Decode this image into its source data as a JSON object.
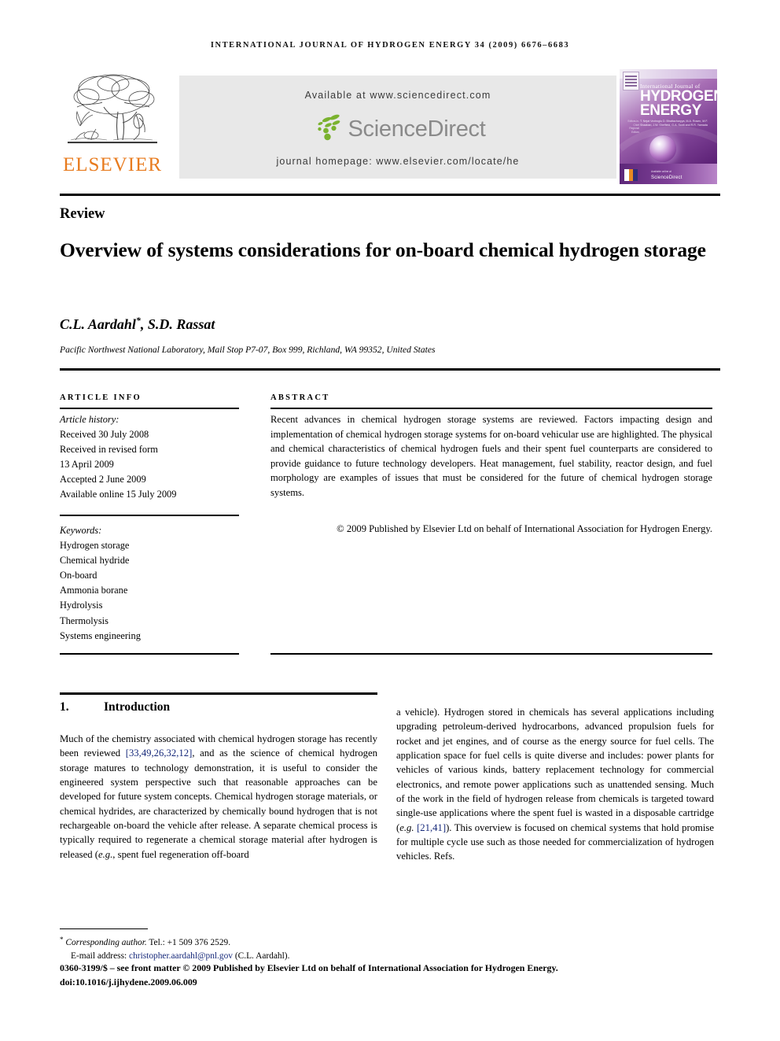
{
  "running_head": "International Journal of Hydrogen Energy 34 (2009) 6676–6683",
  "masthead": {
    "elsevier_wordmark": "ELSEVIER",
    "available_at": "Available at www.sciencedirect.com",
    "sciencedirect_wordmark": "ScienceDirect",
    "journal_homepage": "journal homepage: www.elsevier.com/locate/he",
    "accent_orange": "#E87B1E",
    "banner_gray": "#e8e8e8",
    "logo_gray": "#8a8a8a",
    "leaf_green": "#7AB22E"
  },
  "cover": {
    "intl_journal_of": "International Journal of",
    "hydrogen": "HYDROGEN",
    "energy": "ENERGY",
    "editors_label": "Editors-in-Chief\nRegional Editors",
    "editors": "T. Nejat Veziroglu\nD. Bhattacharyya, M.A. Rosen,\nM.F. Shaaban, J.W. Sheffield,\nG.A. Scott and R.R. Yamada",
    "sciencedirect_small": "ScienceDirect",
    "sciencedirect_tag": "Available online at",
    "bg_purple": "#7b3f93"
  },
  "article": {
    "review_label": "Review",
    "title": "Overview of systems considerations for on-board chemical hydrogen storage",
    "authors_text": "C.L. Aardahl",
    "authors_rest": ", S.D. Rassat",
    "author_marker": "*",
    "affiliation": "Pacific Northwest National Laboratory, Mail Stop P7-07, Box 999, Richland, WA 99352, United States"
  },
  "info": {
    "heading": "Article Info",
    "history_label": "Article history:",
    "history": [
      "Received 30 July 2008",
      "Received in revised form",
      "13 April 2009",
      "Accepted 2 June 2009",
      "Available online 15 July 2009"
    ],
    "keywords_label": "Keywords:",
    "keywords": [
      "Hydrogen storage",
      "Chemical hydride",
      "On-board",
      "Ammonia borane",
      "Hydrolysis",
      "Thermolysis",
      "Systems engineering"
    ]
  },
  "abstract": {
    "heading": "Abstract",
    "body": "Recent advances in chemical hydrogen storage systems are reviewed. Factors impacting design and implementation of chemical hydrogen storage systems for on-board vehicular use are highlighted. The physical and chemical characteristics of chemical hydrogen fuels and their spent fuel counterparts are considered to provide guidance to future technology developers. Heat management, fuel stability, reactor design, and fuel morphology are examples of issues that must be considered for the future of chemical hydrogen storage systems.",
    "copyright": "© 2009 Published by Elsevier Ltd on behalf of International Association for Hydrogen Energy."
  },
  "section": {
    "number": "1.",
    "title": "Introduction"
  },
  "body": {
    "left_p1_a": "Much of the chemistry associated with chemical hydrogen storage has recently been reviewed ",
    "left_cite1": "[33,49,26,32,12]",
    "left_p1_b": ", and as the science of chemical hydrogen storage matures to technology demonstration, it is useful to consider the engineered system perspective such that reasonable approaches can be developed for future system concepts. Chemical hydrogen storage materials, or chemical hydrides, are characterized by chemically bound hydrogen that is not rechargeable on-board the vehicle after release. A separate chemical process is typically required to regenerate a chemical storage material after hydrogen is released (",
    "left_eg": "e.g.",
    "left_p1_c": ", spent fuel regeneration off-board",
    "right_p1_a": "a vehicle). Hydrogen stored in chemicals has several applications including upgrading petroleum-derived hydrocarbons, advanced propulsion fuels for rocket and jet engines, and of course as the energy source for fuel cells. The application space for fuel cells is quite diverse and includes: power plants for vehicles of various kinds, battery replacement technology for commercial electronics, and remote power applications such as unattended sensing. Much of the work in the field of hydrogen release from chemicals is targeted toward single-use applications where the spent fuel is wasted in a disposable cartridge (",
    "right_eg": "e.g.",
    "right_cite1": "[21,41]",
    "right_p1_b": "). This overview is focused on chemical systems that hold promise for multiple cycle use such as those needed for commercialization of hydrogen vehicles. Refs.",
    "link_color": "#16297a"
  },
  "footer": {
    "corresponding_marker": "*",
    "corresponding_label": "Corresponding author.",
    "corresponding_tel": " Tel.: +1 509 376 2529.",
    "email_label": "E-mail address: ",
    "email": "christopher.aardahl@pnl.gov",
    "email_suffix": " (C.L. Aardahl).",
    "issn_line": "0360-3199/$ – see front matter © 2009 Published by Elsevier Ltd on behalf of International Association for Hydrogen Energy.",
    "doi_line": "doi:10.1016/j.ijhydene.2009.06.009"
  }
}
